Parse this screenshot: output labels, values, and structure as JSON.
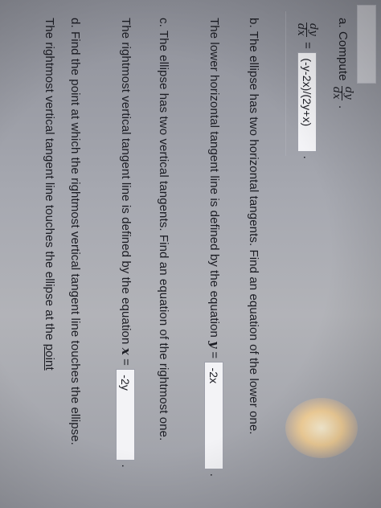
{
  "part_a": {
    "label": "a.",
    "prompt": "Compute",
    "frac_num": "dy",
    "frac_den": "dx",
    "punct": ".",
    "lhs_num": "dy",
    "lhs_den": "dx",
    "equals": "=",
    "answer": "(-y-2x)/(2y+x)",
    "after": "."
  },
  "part_b": {
    "label": "b.",
    "text": "The ellipse has two horizontal tangents. Find an equation of the lower one.",
    "line_text": "The lower horizontal tangent line is defined by the equation",
    "var": "y",
    "equals": "=",
    "answer": "-2x",
    "after": "."
  },
  "part_c": {
    "label": "c.",
    "text": "The ellipse has two vertical tangents. Find an equation of the rightmost one.",
    "line_text": "The rightmost vertical tangent line is defined by the equation",
    "var": "x",
    "equals": "=",
    "answer": "-2y",
    "after": "."
  },
  "part_d": {
    "label": "d.",
    "text": "Find the point at which the rightmost vertical tangent line touches the ellipse.",
    "line_text": "The rightmost vertical tangent line touches the ellipse at the",
    "link": "point"
  }
}
